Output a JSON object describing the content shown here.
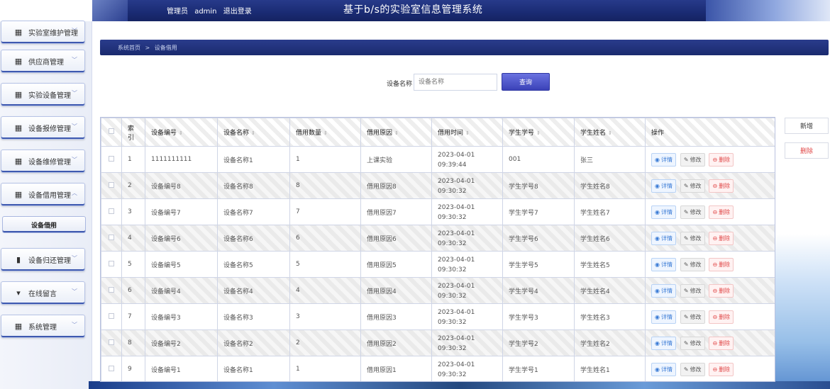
{
  "header": {
    "role_label": "管理员",
    "username": "admin",
    "logout_label": "退出登录",
    "app_title": "基于b/s的实验室信息管理系统"
  },
  "sidebar": {
    "items": [
      {
        "label": "实验室维护管理",
        "icon": "grid-icon"
      },
      {
        "label": "供应商管理",
        "icon": "grid-icon"
      },
      {
        "label": "实验设备管理",
        "icon": "grid-icon"
      },
      {
        "label": "设备报修管理",
        "icon": "grid-icon"
      },
      {
        "label": "设备维修管理",
        "icon": "grid-icon"
      },
      {
        "label": "设备借用管理",
        "icon": "grid-icon"
      },
      {
        "label": "设备归还管理",
        "icon": "bar-chart-icon"
      },
      {
        "label": "在线留言",
        "icon": "filter-icon"
      },
      {
        "label": "系统管理",
        "icon": "table-icon"
      }
    ],
    "active_sub": "设备借用"
  },
  "breadcrumb": {
    "home": "系统首页",
    "sep": ">",
    "current": "设备借用"
  },
  "search": {
    "label": "设备名称",
    "placeholder": "设备名称",
    "button": "查询"
  },
  "actions": {
    "add": "新增",
    "delete": "删除"
  },
  "table": {
    "headers": {
      "index": "索引",
      "code": "设备编号",
      "name": "设备名称",
      "qty": "借用数量",
      "reason": "借用原因",
      "time": "借用时间",
      "student_no": "学生学号",
      "student_name": "学生姓名",
      "ops": "操作"
    },
    "rows": [
      {
        "index": "1",
        "code": "1111111111",
        "name": "设备名称1",
        "qty": "1",
        "reason": "上课实验",
        "time": "2023-04-01 09:39:44",
        "student_no": "001",
        "student_name": "张三"
      },
      {
        "index": "2",
        "code": "设备编号8",
        "name": "设备名称8",
        "qty": "8",
        "reason": "借用原因8",
        "time": "2023-04-01 09:30:32",
        "student_no": "学生学号8",
        "student_name": "学生姓名8"
      },
      {
        "index": "3",
        "code": "设备编号7",
        "name": "设备名称7",
        "qty": "7",
        "reason": "借用原因7",
        "time": "2023-04-01 09:30:32",
        "student_no": "学生学号7",
        "student_name": "学生姓名7"
      },
      {
        "index": "4",
        "code": "设备编号6",
        "name": "设备名称6",
        "qty": "6",
        "reason": "借用原因6",
        "time": "2023-04-01 09:30:32",
        "student_no": "学生学号6",
        "student_name": "学生姓名6"
      },
      {
        "index": "5",
        "code": "设备编号5",
        "name": "设备名称5",
        "qty": "5",
        "reason": "借用原因5",
        "time": "2023-04-01 09:30:32",
        "student_no": "学生学号5",
        "student_name": "学生姓名5"
      },
      {
        "index": "6",
        "code": "设备编号4",
        "name": "设备名称4",
        "qty": "4",
        "reason": "借用原因4",
        "time": "2023-04-01 09:30:32",
        "student_no": "学生学号4",
        "student_name": "学生姓名4"
      },
      {
        "index": "7",
        "code": "设备编号3",
        "name": "设备名称3",
        "qty": "3",
        "reason": "借用原因3",
        "time": "2023-04-01 09:30:32",
        "student_no": "学生学号3",
        "student_name": "学生姓名3"
      },
      {
        "index": "8",
        "code": "设备编号2",
        "name": "设备名称2",
        "qty": "2",
        "reason": "借用原因2",
        "time": "2023-04-01 09:30:32",
        "student_no": "学生学号2",
        "student_name": "学生姓名2"
      },
      {
        "index": "9",
        "code": "设备编号1",
        "name": "设备名称1",
        "qty": "1",
        "reason": "借用原因1",
        "time": "2023-04-01 09:30:32",
        "student_no": "学生学号1",
        "student_name": "学生姓名1"
      }
    ],
    "row_ops": {
      "view": "详情",
      "edit": "修改",
      "delete": "删除"
    }
  },
  "colors": {
    "header_navy": "#1a2b73",
    "accent_blue": "#3e59b0",
    "danger": "#e04848"
  }
}
